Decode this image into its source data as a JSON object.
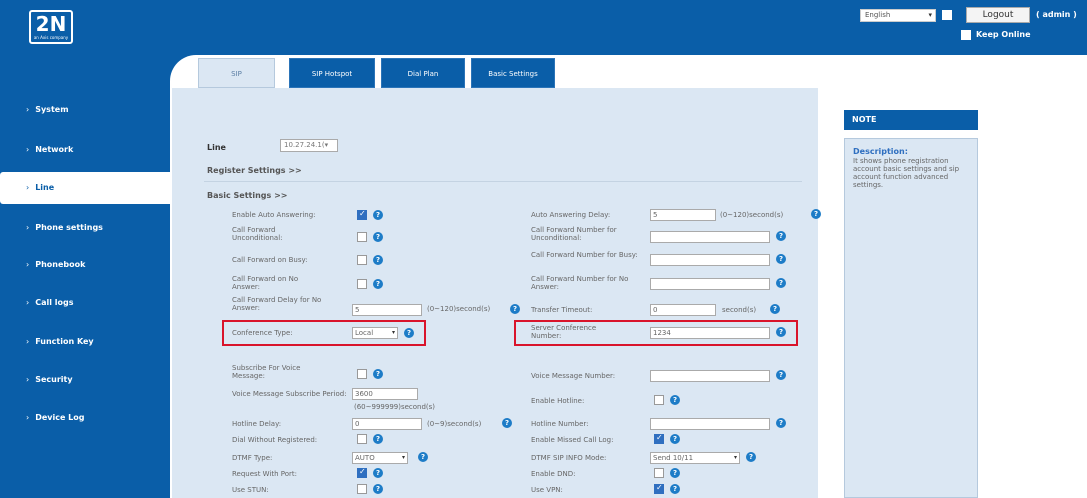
{
  "header": {
    "logo_text": "2N",
    "logo_subtext": "an Axis company",
    "language": "English",
    "logout_label": "Logout",
    "user_label": "( admin )",
    "keep_online_label": "Keep Online"
  },
  "sidebar": {
    "items": [
      {
        "label": "System"
      },
      {
        "label": "Network"
      },
      {
        "label": "Line"
      },
      {
        "label": "Phone settings"
      },
      {
        "label": "Phonebook"
      },
      {
        "label": "Call logs"
      },
      {
        "label": "Function Key"
      },
      {
        "label": "Security"
      },
      {
        "label": "Device Log"
      }
    ]
  },
  "tabs": [
    {
      "label": "SIP"
    },
    {
      "label": "SIP Hotspot"
    },
    {
      "label": "Dial Plan"
    },
    {
      "label": "Basic Settings"
    }
  ],
  "line": {
    "label": "Line",
    "value": "10.27.24.1(▾"
  },
  "sections": {
    "register": "Register Settings >>",
    "basic": "Basic Settings >>"
  },
  "fields": {
    "enable_auto_answering": "Enable Auto Answering:",
    "call_forward_unconditional": "Call Forward Unconditional:",
    "call_forward_on_busy": "Call Forward on Busy:",
    "call_forward_on_no_answer": "Call Forward on No Answer:",
    "call_forward_delay": "Call Forward Delay for No Answer:",
    "call_forward_delay_value": "5",
    "call_forward_delay_unit": "(0~120)second(s)",
    "conference_type": "Conference Type:",
    "conference_type_value": "Local",
    "auto_answering_delay": "Auto Answering Delay:",
    "auto_answering_delay_value": "5",
    "auto_answering_delay_unit": "(0~120)second(s)",
    "cf_number_unconditional": "Call Forward Number for Unconditional:",
    "cf_number_busy": "Call Forward Number for Busy:",
    "cf_number_no_answer": "Call Forward Number for No Answer:",
    "transfer_timeout": "Transfer Timeout:",
    "transfer_timeout_value": "0",
    "transfer_timeout_unit": "second(s)",
    "server_conference_number": "Server Conference Number:",
    "server_conference_number_value": "1234",
    "subscribe_voice_message": "Subscribe For Voice Message:",
    "voice_message_subscribe_period": "Voice Message Subscribe Period:",
    "voice_message_subscribe_period_value": "3600",
    "voice_message_subscribe_period_unit": "(60~999999)second(s)",
    "hotline_delay": "Hotline Delay:",
    "hotline_delay_value": "0",
    "hotline_delay_unit": "(0~9)second(s)",
    "dial_without_registered": "Dial Without Registered:",
    "dtmf_type": "DTMF Type:",
    "dtmf_type_value": "AUTO",
    "request_with_port": "Request With Port:",
    "use_stun": "Use STUN:",
    "voice_message_number": "Voice Message Number:",
    "enable_hotline": "Enable Hotline:",
    "hotline_number": "Hotline Number:",
    "enable_missed_call_log": "Enable Missed Call Log:",
    "dtmf_sip_info_mode": "DTMF SIP INFO Mode:",
    "dtmf_sip_info_mode_value": "Send 10/11",
    "enable_dnd": "Enable DND:",
    "use_vpn": "Use VPN:"
  },
  "note": {
    "header": "NOTE",
    "title": "Description:",
    "text": "It shows phone registration account basic settings and sip account function advanced settings."
  },
  "colors": {
    "brand_blue": "#0a5ea8",
    "panel_bg": "#dbe7f3",
    "highlight_red": "#d9142b"
  }
}
